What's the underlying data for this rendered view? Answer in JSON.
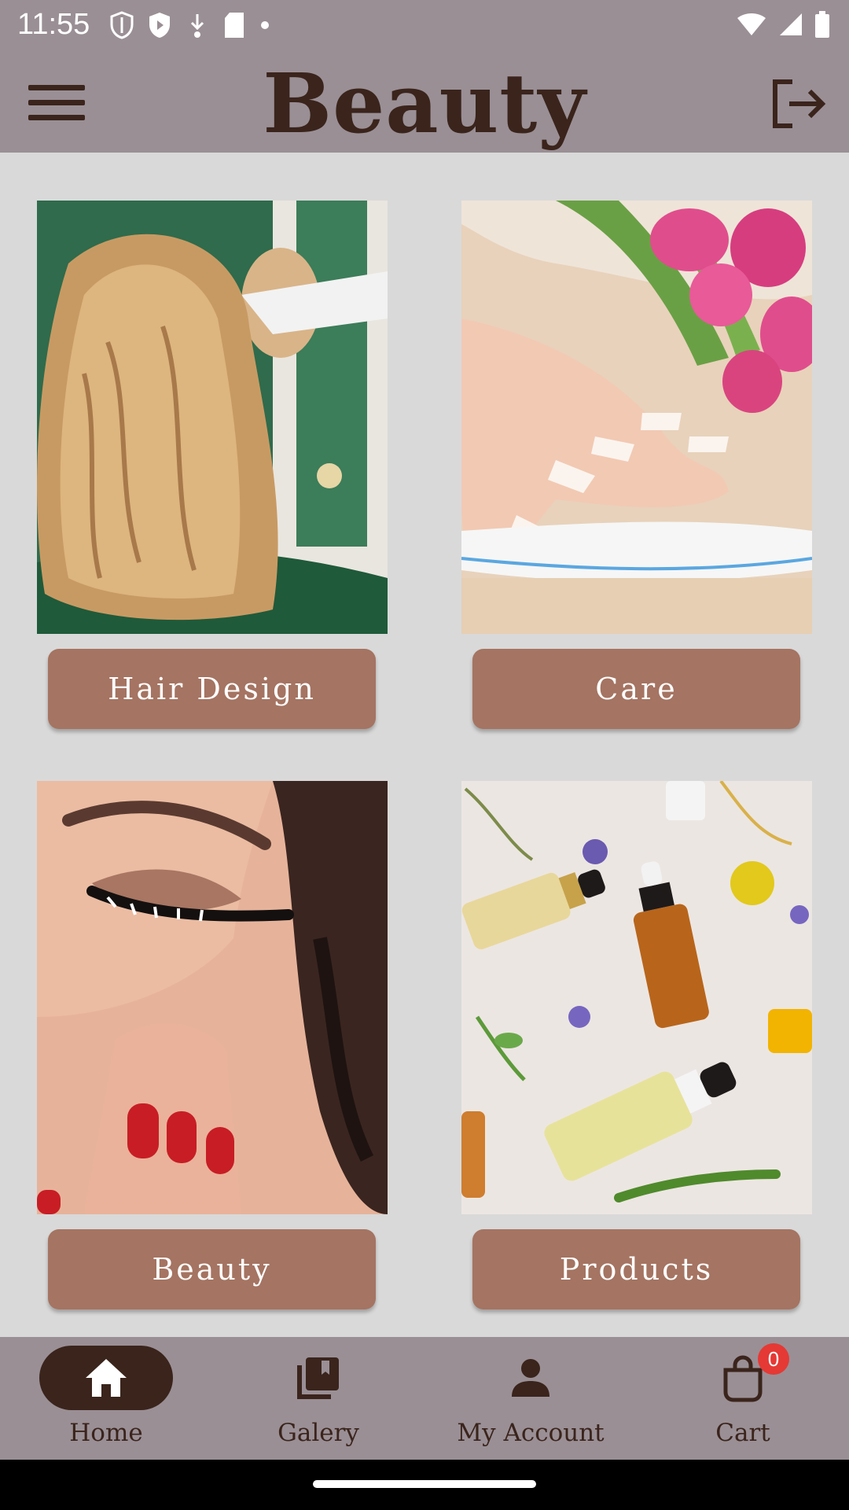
{
  "status_bar": {
    "time": "11:55",
    "left_icons": [
      "shield-icon",
      "play-shield-icon",
      "download-icon",
      "sd-card-icon",
      "dot-icon"
    ],
    "right_icons": [
      "wifi-icon",
      "signal-icon",
      "battery-icon"
    ]
  },
  "app_bar": {
    "title": "Beauty",
    "menu_icon": "hamburger-icon",
    "logout_icon": "logout-icon"
  },
  "tiles": [
    {
      "label": "Hair Design",
      "image": "hair-photo"
    },
    {
      "label": "Care",
      "image": "nails-photo"
    },
    {
      "label": "Beauty",
      "image": "makeup-photo"
    },
    {
      "label": "Products",
      "image": "products-photo"
    }
  ],
  "bottom_nav": {
    "items": [
      {
        "label": "Home",
        "icon": "home-icon",
        "active": true
      },
      {
        "label": "Galery",
        "icon": "gallery-icon",
        "active": false
      },
      {
        "label": "My Account",
        "icon": "person-icon",
        "active": false
      },
      {
        "label": "Cart",
        "icon": "shopping-bag-icon",
        "active": false,
        "badge": "0"
      }
    ]
  },
  "colors": {
    "bar": "#9a8f95",
    "accent": "#a57462",
    "dark": "#3a241c",
    "background": "#d9d9d9",
    "badge": "#e53935"
  }
}
